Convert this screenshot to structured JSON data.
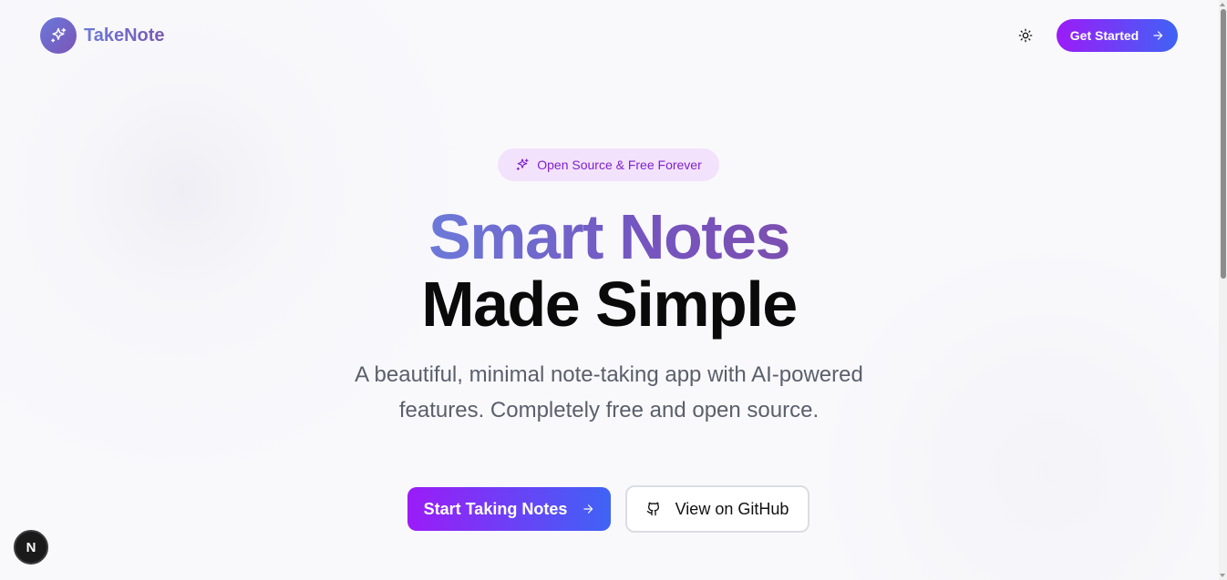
{
  "header": {
    "logo_text": "TakeNote",
    "logo_icon": "sparkles-icon",
    "theme_icon": "sun-icon",
    "get_started_label": "Get Started"
  },
  "hero": {
    "badge_text": "Open Source & Free Forever",
    "title_line1": "Smart Notes",
    "title_line2": "Made Simple",
    "subtitle": "A beautiful, minimal note-taking app with AI-powered features. Completely free and open source.",
    "primary_cta": "Start Taking Notes",
    "secondary_cta": "View on GitHub"
  },
  "dev_badge": {
    "label": "N"
  },
  "colors": {
    "brand_purple": "#9b1cf7",
    "brand_blue": "#3f63f5",
    "title_gradient_start": "#6c7ad9",
    "title_gradient_end": "#7b4fb0",
    "badge_bg": "#f3e2fb",
    "badge_text": "#7e22ce"
  }
}
